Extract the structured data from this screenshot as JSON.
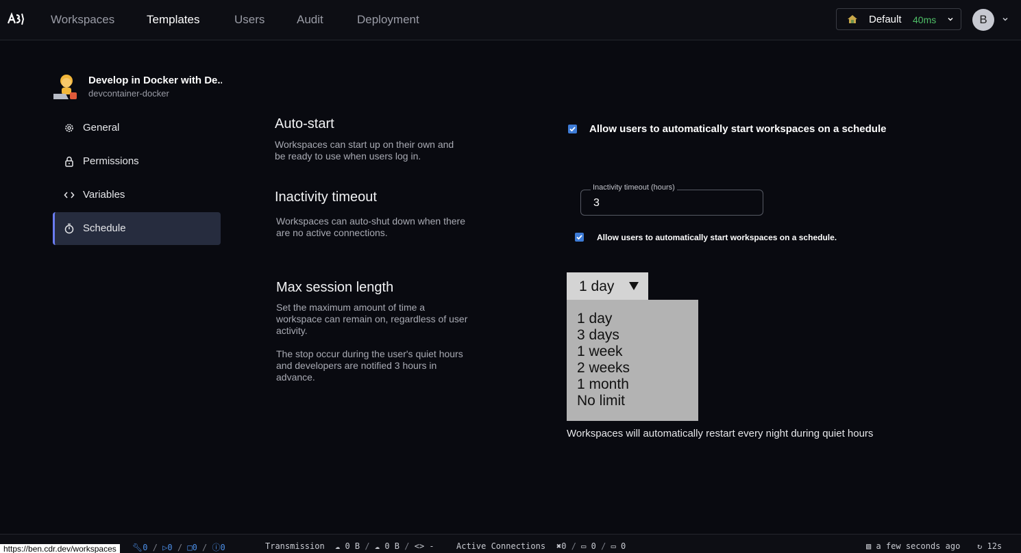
{
  "nav": {
    "items": [
      "Workspaces",
      "Templates",
      "Users",
      "Audit",
      "Deployment"
    ],
    "active": "Templates",
    "env_name": "Default",
    "latency": "40ms",
    "avatar_letter": "B"
  },
  "template": {
    "name": "Develop in Docker with De...",
    "slug": "devcontainer-docker"
  },
  "sidebar": {
    "items": [
      {
        "label": "General",
        "icon": "gear-icon"
      },
      {
        "label": "Permissions",
        "icon": "lock-icon"
      },
      {
        "label": "Variables",
        "icon": "code-icon"
      },
      {
        "label": "Schedule",
        "icon": "timer-icon",
        "active": true
      }
    ]
  },
  "autostart": {
    "title": "Auto-start",
    "desc_lines": [
      "Workspaces can start up on their own and",
      "be ready to use when users log in."
    ],
    "checkbox_label": "Allow users to automatically start workspaces on a schedule",
    "checked": true
  },
  "inactivity": {
    "title": "Inactivity timeout",
    "desc_lines": [
      "Workspaces can auto-shut down when there",
      "are no active connections."
    ],
    "field_label": "Inactivity timeout (hours)",
    "field_value": "3",
    "checkbox_label": "Allow users to automatically start workspaces on a schedule.",
    "checked": true
  },
  "max_session": {
    "title": "Max session length",
    "desc_lines": [
      "Set the maximum amount of time a",
      "workspace can remain on, regardless of user",
      "activity."
    ],
    "desc2_lines": [
      "The stop occur during the user's quiet hours",
      "and developers are notified 3 hours in",
      "advance."
    ],
    "selected": "1 day",
    "options": [
      "1 day",
      "3 days",
      "1 week",
      "2 weeks",
      "1 month",
      "No limit"
    ],
    "hint": "Workspaces will automatically restart every night during quiet hours"
  },
  "status": {
    "url": "https://ben.cdr.dev/workspaces",
    "health_counts": [
      "0",
      "0",
      "0",
      "0"
    ],
    "transmission_label": "Transmission",
    "upload": "0 B",
    "download": "0 B",
    "latency_dash": "-",
    "connections_label": "Active Connections",
    "conn_counts": [
      "0",
      "0",
      "0"
    ],
    "updated": "a few seconds ago",
    "refresh": "12s"
  },
  "colors": {
    "accent": "#6a7cf2",
    "checkbox": "#3d7bd6",
    "latency_green": "#4fbf67"
  }
}
